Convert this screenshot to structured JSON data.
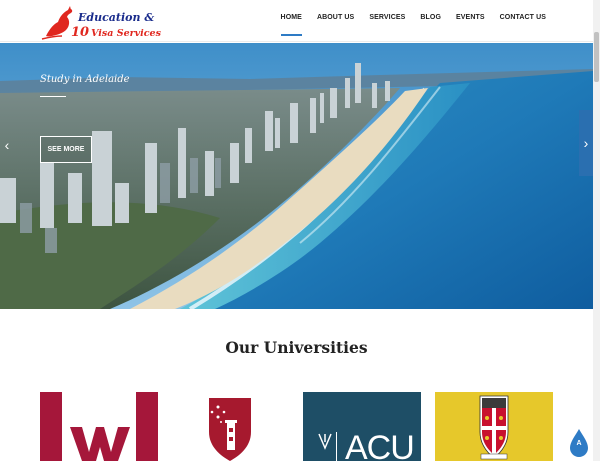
{
  "brand": {
    "line1": "Education &",
    "line2_number": "10",
    "line2_text": "Visa Services"
  },
  "nav": {
    "items": [
      {
        "label": "HOME",
        "active": true
      },
      {
        "label": "ABOUT US",
        "active": false
      },
      {
        "label": "SERVICES",
        "active": false
      },
      {
        "label": "BLOG",
        "active": false
      },
      {
        "label": "EVENTS",
        "active": false
      },
      {
        "label": "CONTACT US",
        "active": false
      }
    ]
  },
  "hero": {
    "title": "Study in Adelaide",
    "button_label": "SEE MORE",
    "prev_icon": "chevron-left-icon",
    "next_icon": "chevron-right-icon"
  },
  "universities": {
    "heading": "Our Universities",
    "logos": [
      {
        "name": "western-sydney-logo",
        "text": "W",
        "bg": "#ffffff",
        "accent": "#a5173a"
      },
      {
        "name": "macquarie-logo",
        "bg": "#ffffff",
        "accent": "#a6192e"
      },
      {
        "name": "acu-logo",
        "text": "ACU",
        "bg": "#1e4e66"
      },
      {
        "name": "unsw-logo",
        "bg": "#e6c82b",
        "accent": "#c8102e"
      }
    ]
  },
  "back_to_top": {
    "label": "A"
  },
  "colors": {
    "accent": "#2e7bc5",
    "slider_arrow_bg": "#2a6fb0"
  }
}
